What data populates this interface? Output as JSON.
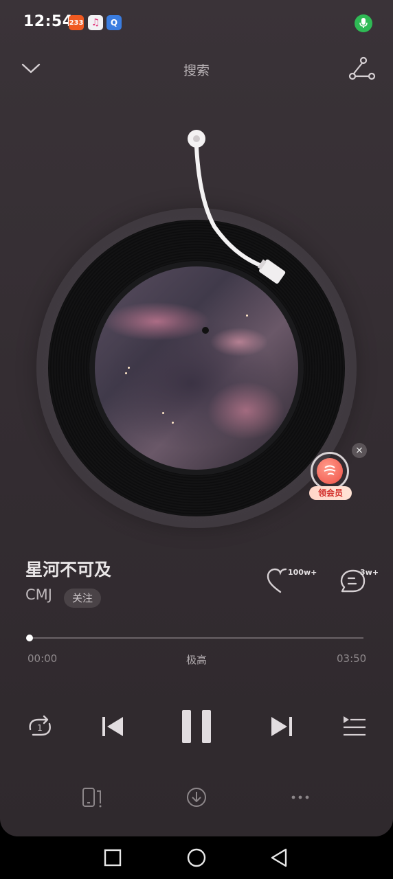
{
  "status_bar": {
    "time": "12:54",
    "app_badges": [
      "233",
      "music",
      "Q"
    ],
    "mic_color": "#2fba55"
  },
  "header": {
    "title": "搜索",
    "collapse_icon": "chevron-down-icon",
    "share_icon": "share-icon"
  },
  "player": {
    "song_title": "星河不可及",
    "artist": "CMJ",
    "follow_label": "关注",
    "like_count": "100w+",
    "comment_count": "3w+",
    "current_time": "00:00",
    "total_time": "03:50",
    "quality": "极高",
    "progress_fraction": 0.0
  },
  "vip_badge": {
    "label": "领会员",
    "close_glyph": "×"
  },
  "controls": [
    "repeat-one-icon",
    "previous-icon",
    "pause-icon",
    "next-icon",
    "playlist-icon"
  ],
  "actions": [
    "device-icon",
    "download-icon",
    "more-icon"
  ],
  "navigation": [
    "recent-apps-icon",
    "home-icon",
    "back-icon"
  ],
  "colors": {
    "background": "#3a3338",
    "accent_vip": "#f05045"
  }
}
